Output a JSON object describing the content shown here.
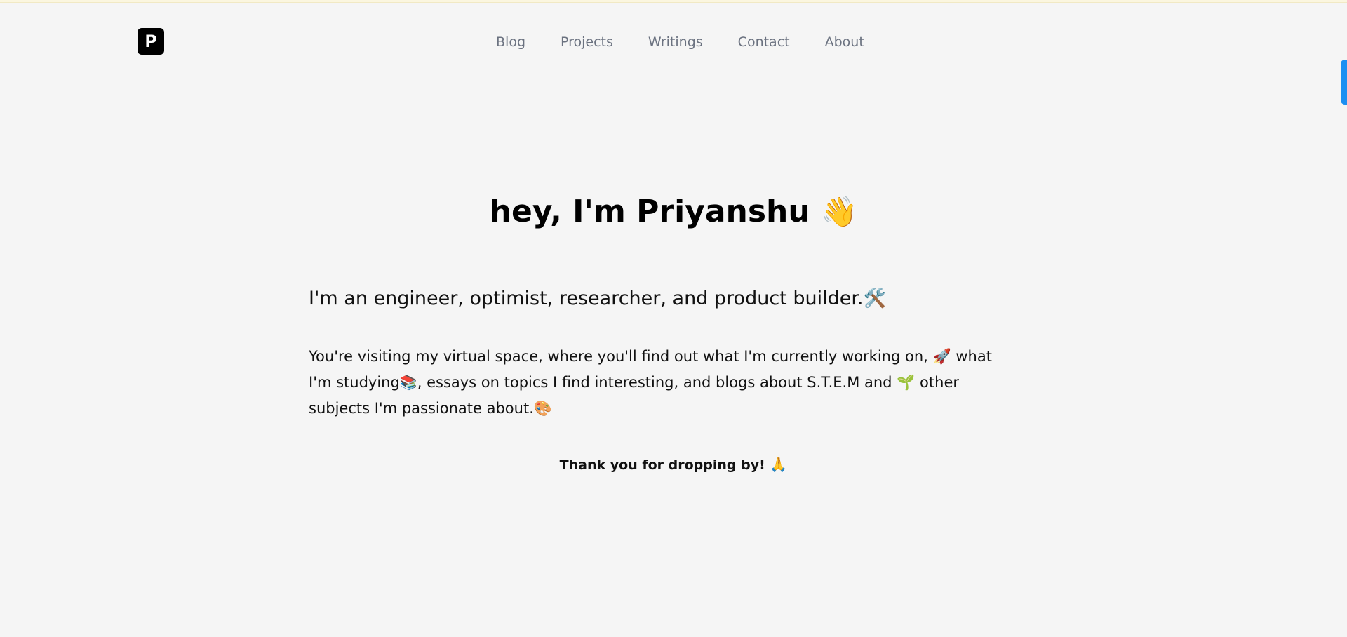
{
  "header": {
    "logo_letter": "P",
    "nav": [
      {
        "label": "Blog"
      },
      {
        "label": "Projects"
      },
      {
        "label": "Writings"
      },
      {
        "label": "Contact"
      },
      {
        "label": "About"
      }
    ]
  },
  "hero": {
    "title": "hey, I'm Priyanshu",
    "title_emoji": "👋"
  },
  "intro": {
    "tagline": "I'm an engineer, optimist, researcher, and product builder.",
    "tagline_emoji": "🛠️",
    "bio_part1": "You're visiting my virtual space, where you'll find out what I'm currently working on,",
    "bio_emoji1": "🚀",
    "bio_part2": "what I'm studying",
    "bio_emoji2": "📚",
    "bio_part3": ", essays on topics I find interesting, and blogs about S.T.E.M and",
    "bio_emoji3": "🌱",
    "bio_part4": "other subjects I'm passionate about.",
    "bio_emoji4": "🎨"
  },
  "footer_note": {
    "thanks": "Thank you for dropping by!",
    "thanks_emoji": "🙏"
  },
  "colors": {
    "background": "#f5f5f5",
    "nav_text": "#6b7280",
    "logo_bg": "#000000",
    "side_tab": "#1d8ff2"
  },
  "icons": {
    "logo": "p-logo-icon",
    "side_tab": "feedback-tab"
  }
}
